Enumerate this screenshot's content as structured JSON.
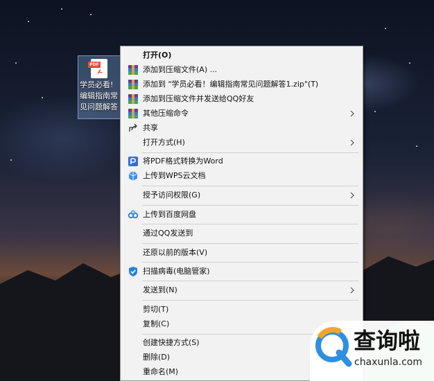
{
  "desktop_file": {
    "label_lines": [
      "学员必看!",
      "编辑指南常",
      "见问题解答"
    ],
    "badge": "PDF"
  },
  "context_menu": {
    "items": [
      {
        "label": "打开(O)",
        "icon": "none",
        "bold": true
      },
      {
        "label": "添加到压缩文件(A) ...",
        "icon": "winrar-archive-icon"
      },
      {
        "label": "添加到 \"学员必看！编辑指南常见问题解答1.zip\"(T)",
        "icon": "winrar-archive-icon"
      },
      {
        "label": "添加到压缩文件并发送给QQ好友",
        "icon": "winrar-archive-icon"
      },
      {
        "label": "其他压缩命令",
        "icon": "winrar-archive-icon",
        "submenu": true
      },
      {
        "label": "共享",
        "icon": "share-icon"
      },
      {
        "label": "打开方式(H)",
        "icon": "none",
        "submenu": true
      },
      {
        "label": "将PDF格式转换为Word",
        "icon": "pdf-convert-icon"
      },
      {
        "label": "上传到WPS云文档",
        "icon": "wps-cloud-icon"
      },
      {
        "label": "授予访问权限(G)",
        "icon": "none",
        "submenu": true
      },
      {
        "label": "上传到百度网盘",
        "icon": "baidu-netdisk-icon"
      },
      {
        "label": "通过QQ发送到",
        "icon": "none"
      },
      {
        "label": "还原以前的版本(V)",
        "icon": "none"
      },
      {
        "label": "扫描病毒(电脑管家)",
        "icon": "pc-manager-shield-icon"
      },
      {
        "label": "发送到(N)",
        "icon": "none",
        "submenu": true
      },
      {
        "label": "剪切(T)",
        "icon": "none"
      },
      {
        "label": "复制(C)",
        "icon": "none"
      },
      {
        "label": "创建快捷方式(S)",
        "icon": "none"
      },
      {
        "label": "删除(D)",
        "icon": "none"
      },
      {
        "label": "重命名(M)",
        "icon": "none"
      }
    ]
  },
  "watermark": {
    "cn": "查询啦",
    "en": "chaxunla.com",
    "accent": "#2f8fe0",
    "accent2": "#f5a623"
  }
}
